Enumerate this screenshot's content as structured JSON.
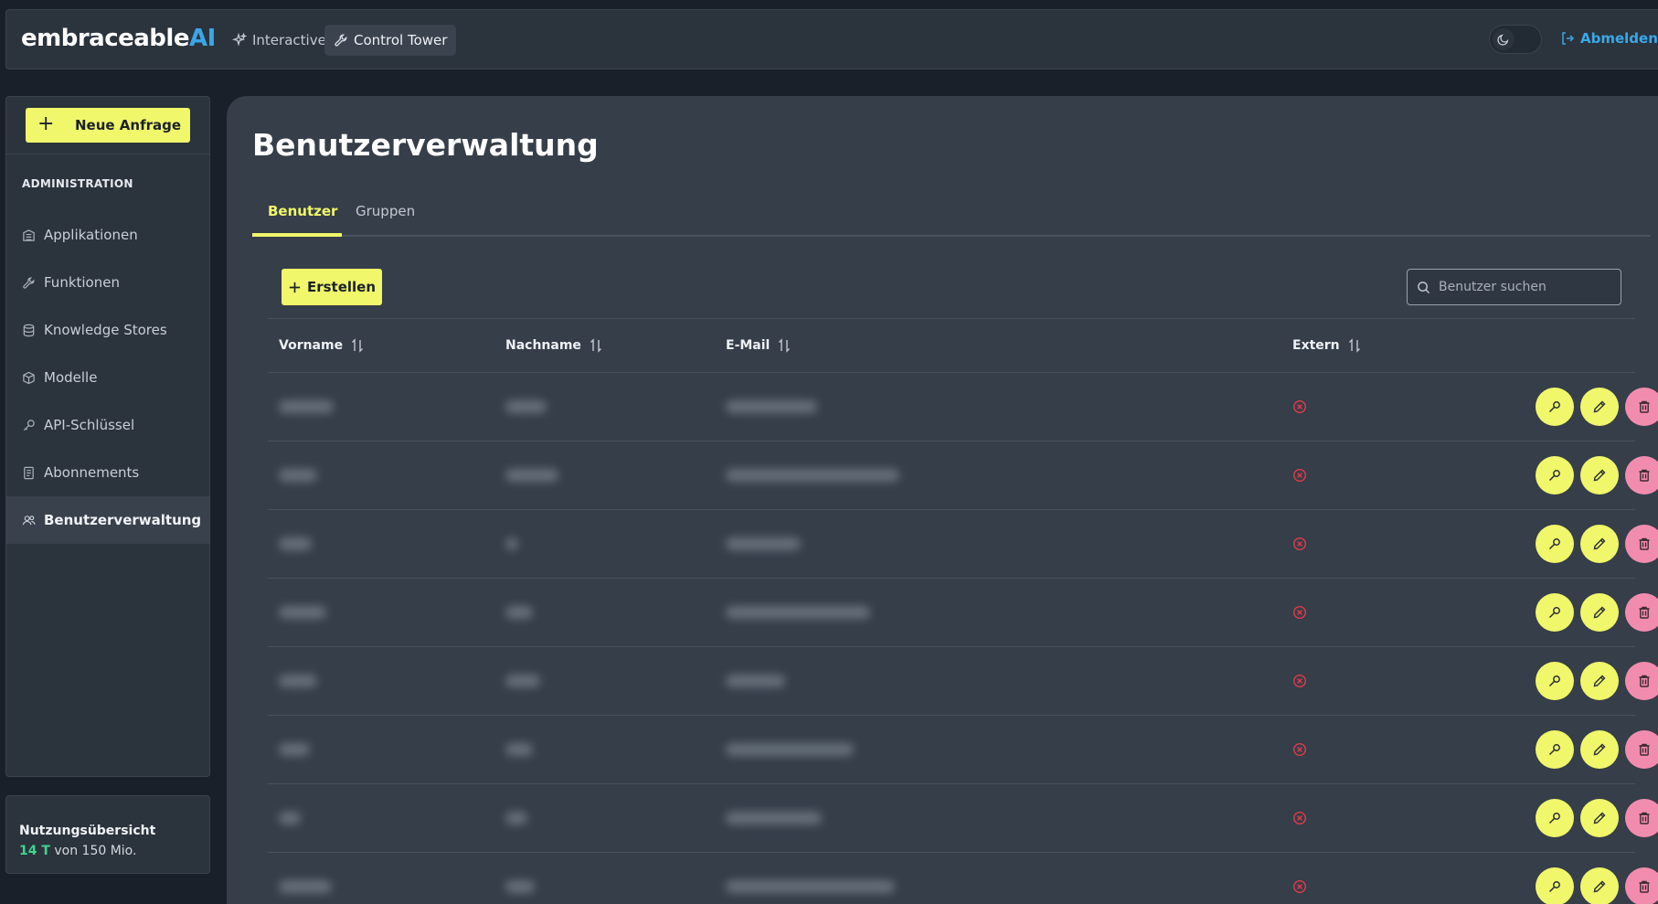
{
  "app": {
    "logo_main": "embraceable",
    "logo_accent": "AI",
    "nav": [
      {
        "label": "Interactive"
      },
      {
        "label": "Control Tower"
      }
    ],
    "logout_label": "Abmelden"
  },
  "sidebar": {
    "new_request_label": "Neue Anfrage",
    "section_title": "ADMINISTRATION",
    "items": [
      {
        "label": "Applikationen"
      },
      {
        "label": "Funktionen"
      },
      {
        "label": "Knowledge Stores"
      },
      {
        "label": "Modelle"
      },
      {
        "label": "API-Schlüssel"
      },
      {
        "label": "Abonnements"
      },
      {
        "label": "Benutzerverwaltung"
      }
    ]
  },
  "usage": {
    "title": "Nutzungsübersicht",
    "used": "14 T",
    "rest": "von 150 Mio."
  },
  "main": {
    "title": "Benutzerverwaltung",
    "tabs": [
      {
        "label": "Benutzer"
      },
      {
        "label": "Gruppen"
      }
    ],
    "create_label": "Erstellen",
    "search_placeholder": "Benutzer suchen",
    "columns": [
      {
        "label": "Vorname"
      },
      {
        "label": "Nachname"
      },
      {
        "label": "E-Mail"
      },
      {
        "label": "Extern"
      }
    ]
  },
  "colors": {
    "accent_yellow": "#f1f76a",
    "danger_pink": "#f28cae",
    "link_blue": "#39a7e6",
    "usage_green": "#3dd68c",
    "extern_false_red": "#e23b4a"
  }
}
